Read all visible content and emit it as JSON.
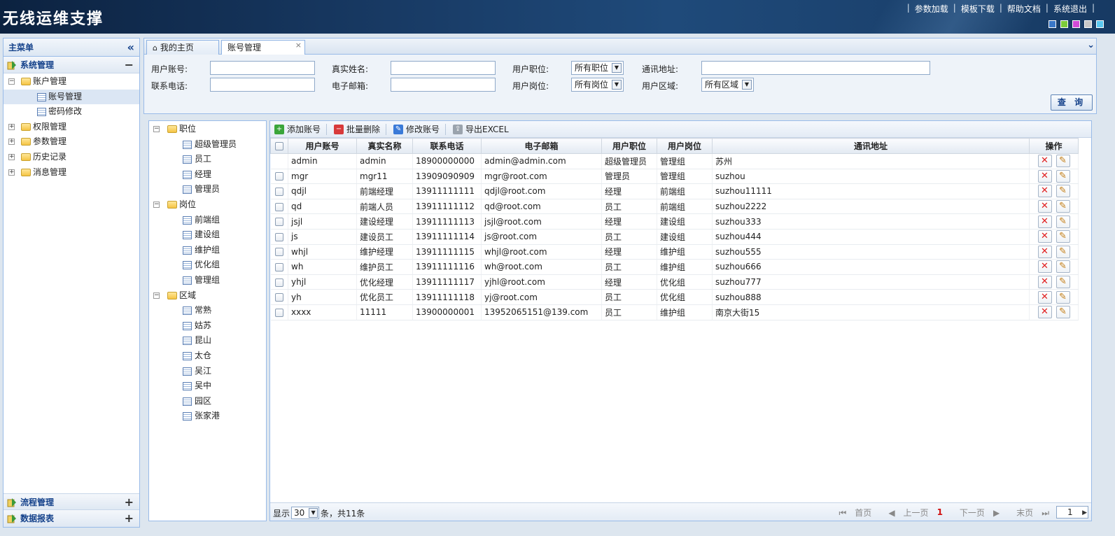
{
  "header": {
    "title": "无线运维支撑",
    "links": [
      "参数加载",
      "模板下载",
      "帮助文档",
      "系统退出"
    ],
    "swatch_colors": [
      "#3a78c8",
      "#7ccb3a",
      "#d24ad8",
      "#c8c8c8",
      "#5ac8f0"
    ]
  },
  "sidebar": {
    "title": "主菜单",
    "sections": {
      "system": "系统管理",
      "flow": "流程管理",
      "report": "数据报表"
    },
    "tree": {
      "account": "账户管理",
      "account_children": [
        "账号管理",
        "密码修改"
      ],
      "others": [
        "权限管理",
        "参数管理",
        "历史记录",
        "消息管理"
      ]
    }
  },
  "tabs": [
    "我的主页",
    "账号管理"
  ],
  "search": {
    "labels": {
      "account": "用户账号:",
      "realname": "真实姓名:",
      "position": "用户职位:",
      "address": "通讯地址:",
      "phone": "联系电话:",
      "email": "电子邮箱:",
      "post": "用户岗位:",
      "area": "用户区域:"
    },
    "selects": {
      "position": "所有职位",
      "post": "所有岗位",
      "area": "所有区域"
    },
    "button": "查 询"
  },
  "filter_tree": {
    "groups": [
      {
        "label": "职位",
        "items": [
          "超级管理员",
          "员工",
          "经理",
          "管理员"
        ]
      },
      {
        "label": "岗位",
        "items": [
          "前端组",
          "建设组",
          "维护组",
          "优化组",
          "管理组"
        ]
      },
      {
        "label": "区域",
        "items": [
          "常熟",
          "姑苏",
          "昆山",
          "太仓",
          "吴江",
          "吴中",
          "园区",
          "张家港"
        ]
      }
    ]
  },
  "toolbar": {
    "add": "添加账号",
    "batch_delete": "批量删除",
    "edit": "修改账号",
    "export": "导出EXCEL"
  },
  "table": {
    "columns": [
      "用户账号",
      "真实名称",
      "联系电话",
      "电子邮箱",
      "用户职位",
      "用户岗位",
      "通讯地址",
      "操作"
    ],
    "rows": [
      [
        "admin",
        "admin",
        "18900000000",
        "admin@admin.com",
        "超级管理员",
        "管理组",
        "苏州"
      ],
      [
        "mgr",
        "mgr11",
        "13909090909",
        "mgr@root.com",
        "管理员",
        "管理组",
        "suzhou"
      ],
      [
        "qdjl",
        "前端经理",
        "13911111111",
        "qdjl@root.com",
        "经理",
        "前端组",
        "suzhou11111"
      ],
      [
        "qd",
        "前端人员",
        "13911111112",
        "qd@root.com",
        "员工",
        "前端组",
        "suzhou2222"
      ],
      [
        "jsjl",
        "建设经理",
        "13911111113",
        "jsjl@root.com",
        "经理",
        "建设组",
        "suzhou333"
      ],
      [
        "js",
        "建设员工",
        "13911111114",
        "js@root.com",
        "员工",
        "建设组",
        "suzhou444"
      ],
      [
        "whjl",
        "维护经理",
        "13911111115",
        "whjl@root.com",
        "经理",
        "维护组",
        "suzhou555"
      ],
      [
        "wh",
        "维护员工",
        "13911111116",
        "wh@root.com",
        "员工",
        "维护组",
        "suzhou666"
      ],
      [
        "yhjl",
        "优化经理",
        "13911111117",
        "yjhl@root.com",
        "经理",
        "优化组",
        "suzhou777"
      ],
      [
        "yh",
        "优化员工",
        "13911111118",
        "yj@root.com",
        "员工",
        "优化组",
        "suzhou888"
      ],
      [
        "xxxx",
        "11111",
        "13900000001",
        "13952065151@139.com",
        "员工",
        "维护组",
        "南京大街15"
      ]
    ]
  },
  "pager": {
    "show": "显示",
    "page_size": "30",
    "total": "条，共11条",
    "first": "首页",
    "prev": "上一页",
    "current": "1",
    "next": "下一页",
    "last": "末页",
    "page_input": "1"
  }
}
